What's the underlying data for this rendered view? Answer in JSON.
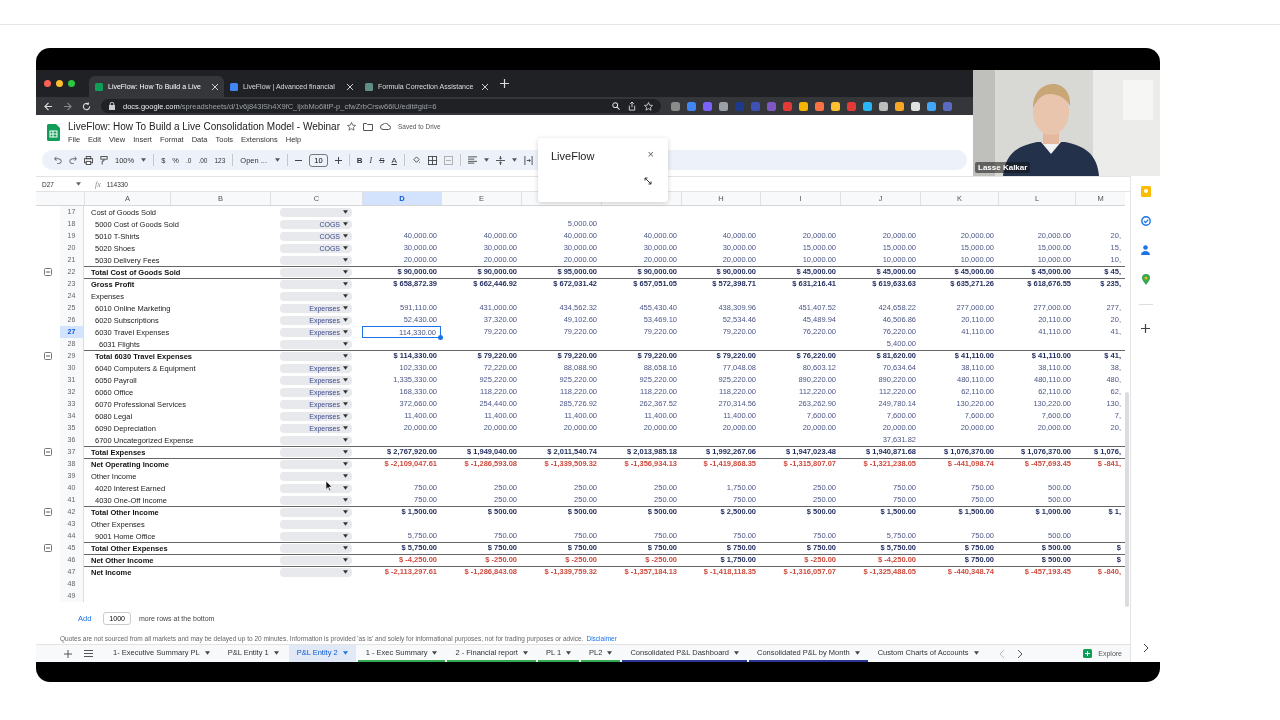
{
  "browser": {
    "tabs": [
      {
        "title": "LiveFlow: How To Build a Live",
        "selected": true
      },
      {
        "title": "LiveFlow | Advanced financial",
        "selected": false
      },
      {
        "title": "Formula Correction Assistance",
        "selected": false
      }
    ],
    "url_host": "docs.google.com",
    "url_path": "/spreadsheets/d/1v6j843lSh4X9fC_ijxbMo6litP-p_cfwZrbCrsw66iU/edit#gid=6"
  },
  "document": {
    "title": "LiveFlow: How To Build a Live Consolidation Model - Webinar",
    "save_status": "Saved to Drive",
    "menu": [
      "File",
      "Edit",
      "View",
      "Insert",
      "Format",
      "Data",
      "Tools",
      "Extensions",
      "Help"
    ]
  },
  "toolbar": {
    "zoom": "100%",
    "currency": "$",
    "percent": "%",
    "decrease_decimals": ".0",
    "increase_decimals": ".00",
    "number_format": "123",
    "font": "Open ...",
    "font_size": "10",
    "bold": "B",
    "italic": "I",
    "strikethrough": "S",
    "text_color": "A"
  },
  "formula_bar": {
    "cell": "D27",
    "fx": "fx",
    "value": "114330"
  },
  "video": {
    "name": "Lasse Kalkar"
  },
  "popup": {
    "title": "LiveFlow",
    "close": "×"
  },
  "grid": {
    "columns": [
      {
        "header": "A",
        "selected": false
      },
      {
        "header": "B",
        "selected": false
      },
      {
        "header": "C",
        "selected": false
      },
      {
        "header": "D",
        "selected": true
      },
      {
        "header": "E",
        "selected": false
      },
      {
        "selected": false
      },
      {
        "selected": false
      },
      {
        "header": "H",
        "selected": false
      },
      {
        "header": "I",
        "selected": false
      },
      {
        "header": "J",
        "selected": false
      },
      {
        "header": "K",
        "selected": false
      },
      {
        "header": "L",
        "selected": false
      },
      {
        "header": "M",
        "selected": false
      }
    ],
    "rows": [
      {
        "number": "17",
        "kind": "section",
        "label": "Cost of Goods Sold",
        "toggle": false,
        "selected": false
      },
      {
        "number": "18",
        "kind": "item",
        "label": "5000 Cost of Goods Sold",
        "category": "COGS",
        "toggle": false,
        "selected": false,
        "cells": [
          null,
          null,
          "5,000.00",
          null,
          null,
          null,
          null,
          null,
          null,
          null
        ]
      },
      {
        "number": "19",
        "kind": "item",
        "label": "5010 T-Shirts",
        "category": "COGS",
        "toggle": false,
        "selected": false,
        "cells": [
          "40,000.00",
          "40,000.00",
          "40,000.00",
          "40,000.00",
          "40,000.00",
          "20,000.00",
          "20,000.00",
          "20,000.00",
          "20,000.00",
          "20,"
        ]
      },
      {
        "number": "20",
        "kind": "item",
        "label": "5020 Shoes",
        "category": "COGS",
        "toggle": false,
        "selected": false,
        "cells": [
          "30,000.00",
          "30,000.00",
          "30,000.00",
          "30,000.00",
          "30,000.00",
          "15,000.00",
          "15,000.00",
          "15,000.00",
          "15,000.00",
          "15,"
        ]
      },
      {
        "number": "21",
        "kind": "item",
        "label": "5030 Delivery Fees",
        "toggle": false,
        "selected": false,
        "cells": [
          "20,000.00",
          "20,000.00",
          "20,000.00",
          "20,000.00",
          "20,000.00",
          "10,000.00",
          "10,000.00",
          "10,000.00",
          "10,000.00",
          "10,"
        ]
      },
      {
        "number": "22",
        "kind": "total",
        "label": "Total Cost of Goods Sold",
        "toggle": true,
        "selected": false,
        "cells": [
          "$ 90,000.00",
          "$ 90,000.00",
          "$ 95,000.00",
          "$ 90,000.00",
          "$ 90,000.00",
          "$ 45,000.00",
          "$ 45,000.00",
          "$ 45,000.00",
          "$ 45,000.00",
          "$ 45,"
        ]
      },
      {
        "number": "23",
        "kind": "net",
        "label": "Gross Profit",
        "toggle": false,
        "selected": false,
        "cells": [
          "$ 658,872.39",
          "$ 662,446.92",
          "$ 672,031.42",
          "$ 657,051.05",
          "$ 572,398.71",
          "$ 631,216.41",
          "$ 619,633.63",
          "$ 635,271.26",
          "$ 618,676.55",
          "$ 235,"
        ],
        "negative": [
          false,
          false,
          false,
          false,
          false,
          false,
          false,
          false,
          false,
          false
        ]
      },
      {
        "number": "24",
        "kind": "section",
        "label": "Expenses",
        "toggle": false,
        "selected": false
      },
      {
        "number": "25",
        "kind": "item",
        "label": "6010 Online Marketing",
        "category": "Expenses",
        "toggle": false,
        "selected": false,
        "cells": [
          "591,110.00",
          "431,000.00",
          "434,562.32",
          "455,430.40",
          "438,309.96",
          "451,407.52",
          "424,658.22",
          "277,000.00",
          "277,000.00",
          "277,"
        ]
      },
      {
        "number": "26",
        "kind": "item",
        "label": "6020 Subscriptions",
        "category": "Expenses",
        "toggle": false,
        "selected": false,
        "cells": [
          "52,430.00",
          "37,320.00",
          "49,102.60",
          "53,469.10",
          "52,534.46",
          "45,489.94",
          "46,506.86",
          "20,110.00",
          "20,110.00",
          "20,"
        ]
      },
      {
        "number": "27",
        "kind": "item",
        "label": "6030 Travel Expenses",
        "category": "Expenses",
        "toggle": false,
        "selected": true,
        "cells": [
          "114,330.00",
          "79,220.00",
          "79,220.00",
          "79,220.00",
          "79,220.00",
          "76,220.00",
          "76,220.00",
          "41,110.00",
          "41,110.00",
          "41,"
        ]
      },
      {
        "number": "28",
        "kind": "subitem",
        "label": "6031 Flights",
        "toggle": false,
        "selected": false,
        "cells": [
          null,
          null,
          null,
          null,
          null,
          null,
          "5,400.00",
          null,
          null,
          null
        ]
      },
      {
        "number": "29",
        "kind": "subtotal",
        "label": "Total 6030 Travel Expenses",
        "toggle": true,
        "selected": false,
        "cells": [
          "$ 114,330.00",
          "$ 79,220.00",
          "$ 79,220.00",
          "$ 79,220.00",
          "$ 79,220.00",
          "$ 76,220.00",
          "$ 81,620.00",
          "$ 41,110.00",
          "$ 41,110.00",
          "$ 41,"
        ]
      },
      {
        "number": "30",
        "kind": "item",
        "label": "6040 Computers & Equipment",
        "category": "Expenses",
        "toggle": false,
        "selected": false,
        "cells": [
          "102,330.00",
          "72,220.00",
          "88,088.90",
          "88,658.16",
          "77,048.08",
          "80,603.12",
          "70,634.64",
          "38,110.00",
          "38,110.00",
          "38,"
        ]
      },
      {
        "number": "31",
        "kind": "item",
        "label": "6050 Payroll",
        "category": "Expenses",
        "toggle": false,
        "selected": false,
        "cells": [
          "1,335,330.00",
          "925,220.00",
          "925,220.00",
          "925,220.00",
          "925,220.00",
          "890,220.00",
          "890,220.00",
          "480,110.00",
          "480,110.00",
          "480,"
        ]
      },
      {
        "number": "32",
        "kind": "item",
        "label": "6060 Office",
        "category": "Expenses",
        "toggle": false,
        "selected": false,
        "cells": [
          "168,330.00",
          "118,220.00",
          "118,220.00",
          "118,220.00",
          "118,220.00",
          "112,220.00",
          "112,220.00",
          "62,110.00",
          "62,110.00",
          "62,"
        ]
      },
      {
        "number": "33",
        "kind": "item",
        "label": "6070 Professional Services",
        "category": "Expenses",
        "toggle": false,
        "selected": false,
        "cells": [
          "372,660.00",
          "254,440.00",
          "285,726.92",
          "262,367.52",
          "270,314.56",
          "263,262.90",
          "249,780.14",
          "130,220.00",
          "130,220.00",
          "130,"
        ]
      },
      {
        "number": "34",
        "kind": "item",
        "label": "6080 Legal",
        "category": "Expenses",
        "toggle": false,
        "selected": false,
        "cells": [
          "11,400.00",
          "11,400.00",
          "11,400.00",
          "11,400.00",
          "11,400.00",
          "7,600.00",
          "7,600.00",
          "7,600.00",
          "7,600.00",
          "7,"
        ]
      },
      {
        "number": "35",
        "kind": "item",
        "label": "6090 Depreciation",
        "category": "Expenses",
        "toggle": false,
        "selected": false,
        "cells": [
          "20,000.00",
          "20,000.00",
          "20,000.00",
          "20,000.00",
          "20,000.00",
          "20,000.00",
          "20,000.00",
          "20,000.00",
          "20,000.00",
          "20,"
        ]
      },
      {
        "number": "36",
        "kind": "item",
        "label": "6700 Uncategorized Expense",
        "toggle": false,
        "selected": false,
        "cells": [
          null,
          null,
          null,
          null,
          null,
          null,
          "37,631.82",
          null,
          null,
          null
        ]
      },
      {
        "number": "37",
        "kind": "total",
        "label": "Total Expenses",
        "toggle": true,
        "selected": false,
        "cells": [
          "$ 2,767,920.00",
          "$ 1,949,040.00",
          "$ 2,011,540.74",
          "$ 2,013,985.18",
          "$ 1,992,267.06",
          "$ 1,947,023.48",
          "$ 1,940,871.68",
          "$ 1,076,370.00",
          "$ 1,076,370.00",
          "$ 1,076,"
        ]
      },
      {
        "number": "38",
        "kind": "net",
        "label": "Net Operating Income",
        "toggle": false,
        "selected": false,
        "cells": [
          "$ -2,109,047.61",
          "$ -1,286,593.08",
          "$ -1,339,509.32",
          "$ -1,356,934.13",
          "$ -1,419,868.35",
          "$ -1,315,807.07",
          "$ -1,321,238.05",
          "$ -441,098.74",
          "$ -457,693.45",
          "$ -841,"
        ],
        "negative": [
          true,
          true,
          true,
          true,
          true,
          true,
          true,
          true,
          true,
          true
        ]
      },
      {
        "number": "39",
        "kind": "section",
        "label": "Other Income",
        "toggle": false,
        "selected": false
      },
      {
        "number": "40",
        "kind": "item",
        "label": "4020 Interest Earned",
        "toggle": false,
        "selected": false,
        "cells": [
          "750.00",
          "250.00",
          "250.00",
          "250.00",
          "1,750.00",
          "250.00",
          "750.00",
          "750.00",
          "500.00",
          null
        ]
      },
      {
        "number": "41",
        "kind": "item",
        "label": "4030 One-Off Income",
        "toggle": false,
        "selected": false,
        "cells": [
          "750.00",
          "250.00",
          "250.00",
          "250.00",
          "750.00",
          "250.00",
          "750.00",
          "750.00",
          "500.00",
          null
        ]
      },
      {
        "number": "42",
        "kind": "total",
        "label": "Total Other Income",
        "toggle": true,
        "selected": false,
        "cells": [
          "$ 1,500.00",
          "$ 500.00",
          "$ 500.00",
          "$ 500.00",
          "$ 2,500.00",
          "$ 500.00",
          "$ 1,500.00",
          "$ 1,500.00",
          "$ 1,000.00",
          "$ 1,"
        ]
      },
      {
        "number": "43",
        "kind": "section",
        "label": "Other Expenses",
        "toggle": false,
        "selected": false
      },
      {
        "number": "44",
        "kind": "item",
        "label": "9001 Home Office",
        "toggle": false,
        "selected": false,
        "cells": [
          "5,750.00",
          "750.00",
          "750.00",
          "750.00",
          "750.00",
          "750.00",
          "5,750.00",
          "750.00",
          "500.00",
          null
        ]
      },
      {
        "number": "45",
        "kind": "total",
        "label": "Total Other Expenses",
        "toggle": true,
        "selected": false,
        "cells": [
          "$ 5,750.00",
          "$ 750.00",
          "$ 750.00",
          "$ 750.00",
          "$ 750.00",
          "$ 750.00",
          "$ 5,750.00",
          "$ 750.00",
          "$ 500.00",
          "$"
        ]
      },
      {
        "number": "46",
        "kind": "net",
        "label": "Net Other Income",
        "toggle": false,
        "selected": false,
        "cells": [
          "$ -4,250.00",
          "$ -250.00",
          "$ -250.00",
          "$ -250.00",
          "$ 1,750.00",
          "$ -250.00",
          "$ -4,250.00",
          "$ 750.00",
          "$ 500.00",
          "$"
        ],
        "negative": [
          true,
          true,
          true,
          true,
          false,
          true,
          true,
          false,
          false,
          false
        ]
      },
      {
        "number": "47",
        "kind": "net",
        "label": "Net Income",
        "toggle": false,
        "selected": false,
        "cells": [
          "$ -2,113,297.61",
          "$ -1,286,843.08",
          "$ -1,339,759.32",
          "$ -1,357,184.13",
          "$ -1,418,118.35",
          "$ -1,316,057.07",
          "$ -1,325,488.05",
          "$ -440,348.74",
          "$ -457,193.45",
          "$ -840,"
        ],
        "negative": [
          true,
          true,
          true,
          true,
          true,
          true,
          true,
          true,
          true,
          true
        ]
      },
      {
        "number": "48",
        "kind": "empty",
        "toggle": false,
        "selected": false
      },
      {
        "number": "49",
        "kind": "empty",
        "toggle": false,
        "selected": false
      }
    ]
  },
  "add_rows": {
    "button": "Add",
    "count": "1000",
    "suffix": "more rows at the bottom"
  },
  "footnote": {
    "text": "Quotes are not sourced from all markets and may be delayed up to 20 minutes. Information is provided 'as is' and solely for informational purposes, not for trading purposes or advice.",
    "link": "Disclaimer"
  },
  "sheet_tabs": [
    {
      "label": "1- Executive Summary PL",
      "selected": false
    },
    {
      "label": "P&L Entity 1",
      "selected": false
    },
    {
      "label": "P&L Entity 2",
      "selected": true
    },
    {
      "label": "1 - Exec Summary",
      "selected": false,
      "color": "#34a853"
    },
    {
      "label": "2 - Financial report",
      "selected": false,
      "color": "#34a853"
    },
    {
      "label": "PL 1",
      "selected": false,
      "color": "#34a853"
    },
    {
      "label": "PL2",
      "selected": false,
      "color": "#34a853"
    },
    {
      "label": "Consolidated P&L Dashboard",
      "selected": false,
      "color": "#283593"
    },
    {
      "label": "Consolidated P&L by Month",
      "selected": false,
      "color": "#283593"
    },
    {
      "label": "Custom Charts of Accounts",
      "selected": false
    }
  ],
  "explore": "Explore"
}
